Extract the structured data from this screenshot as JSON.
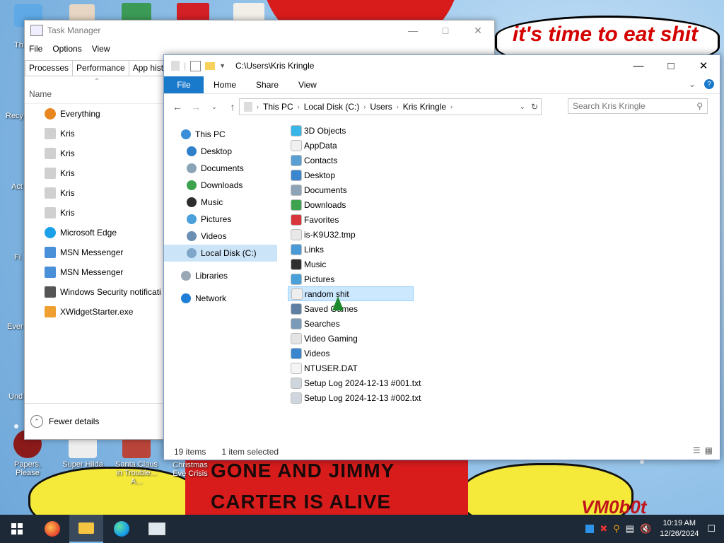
{
  "desktop": {
    "speech_text": "it's time to eat shit",
    "poster_line1": "GONE AND JIMMY",
    "poster_line2": "CARTER IS ALIVE",
    "signature": "VM0b0t",
    "icons": [
      {
        "label": "Papers, Please"
      },
      {
        "label": "Super Hilda"
      },
      {
        "label": "Santa Claus in Trouble... A..."
      },
      {
        "label": "Christmas Eve Crisis"
      }
    ],
    "left_labels": [
      "Th",
      "Recy",
      "Act",
      "Fi",
      "Ever",
      "Und"
    ]
  },
  "task_manager": {
    "title": "Task Manager",
    "menu": [
      "File",
      "Options",
      "View"
    ],
    "tabs": [
      "Processes",
      "Performance",
      "App histo"
    ],
    "column": "Name",
    "rows": [
      {
        "name": "Everything",
        "icon": "search-icon"
      },
      {
        "name": "Kris",
        "icon": "app-icon"
      },
      {
        "name": "Kris",
        "icon": "app-icon"
      },
      {
        "name": "Kris",
        "icon": "app-icon"
      },
      {
        "name": "Kris",
        "icon": "app-icon"
      },
      {
        "name": "Kris",
        "icon": "app-icon"
      },
      {
        "name": "Microsoft Edge",
        "icon": "edge-icon"
      },
      {
        "name": "MSN Messenger",
        "icon": "msn-icon"
      },
      {
        "name": "MSN Messenger",
        "icon": "msn-icon"
      },
      {
        "name": "Windows Security notificati",
        "icon": "shield-icon"
      },
      {
        "name": "XWidgetStarter.exe",
        "icon": "widget-icon"
      }
    ],
    "fewer_details": "Fewer details"
  },
  "explorer": {
    "title_path": "C:\\Users\\Kris Kringle",
    "ribbon": {
      "file": "File",
      "home": "Home",
      "share": "Share",
      "view": "View"
    },
    "breadcrumbs": [
      "This PC",
      "Local Disk (C:)",
      "Users",
      "Kris Kringle"
    ],
    "search_placeholder": "Search Kris Kringle",
    "nav": [
      {
        "label": "This PC",
        "color": "#3a8fd6"
      },
      {
        "label": "Desktop",
        "color": "#2f7fc9"
      },
      {
        "label": "Documents",
        "color": "#8aa4b8"
      },
      {
        "label": "Downloads",
        "color": "#3da34f"
      },
      {
        "label": "Music",
        "color": "#2d2d2d"
      },
      {
        "label": "Pictures",
        "color": "#4aa0d8"
      },
      {
        "label": "Videos",
        "color": "#6b8fb0"
      },
      {
        "label": "Local Disk (C:)",
        "color": "#7fa6c8"
      },
      {
        "label": "Libraries",
        "color": "#9aa8b5"
      },
      {
        "label": "Network",
        "color": "#1f7ed6"
      }
    ],
    "items": [
      {
        "name": "3D Objects",
        "color": "#38b6e8"
      },
      {
        "name": "AppData",
        "color": "#f0f0f0"
      },
      {
        "name": "Contacts",
        "color": "#5a9fd4"
      },
      {
        "name": "Desktop",
        "color": "#3a86cf"
      },
      {
        "name": "Documents",
        "color": "#8ea4b6"
      },
      {
        "name": "Downloads",
        "color": "#3da34f"
      },
      {
        "name": "Favorites",
        "color": "#d9363b"
      },
      {
        "name": "is-K9U32.tmp",
        "color": "#e8e8e8"
      },
      {
        "name": "Links",
        "color": "#4a9ad8"
      },
      {
        "name": "Music",
        "color": "#2f2f2f"
      },
      {
        "name": "Pictures",
        "color": "#4aa0d8"
      },
      {
        "name": "random shit",
        "color": "#eeeeee"
      },
      {
        "name": "Saved Games",
        "color": "#5e7fa2"
      },
      {
        "name": "Searches",
        "color": "#7a9bb8"
      },
      {
        "name": "Video Gaming",
        "color": "#e4e4e4"
      },
      {
        "name": "Videos",
        "color": "#3a86cf"
      },
      {
        "name": "NTUSER.DAT",
        "color": "#f4f4f4"
      },
      {
        "name": "Setup Log 2024-12-13 #001.txt",
        "color": "#cfd6dd"
      },
      {
        "name": "Setup Log 2024-12-13 #002.txt",
        "color": "#cfd6dd"
      }
    ],
    "status_count": "19 items",
    "status_selected": "1 item selected"
  },
  "taskbar": {
    "time": "10:19 AM",
    "date": "12/26/2024",
    "apps": [
      "start-icon",
      "firefox-icon",
      "file-explorer-icon",
      "edge-icon",
      "task-manager-icon"
    ]
  }
}
